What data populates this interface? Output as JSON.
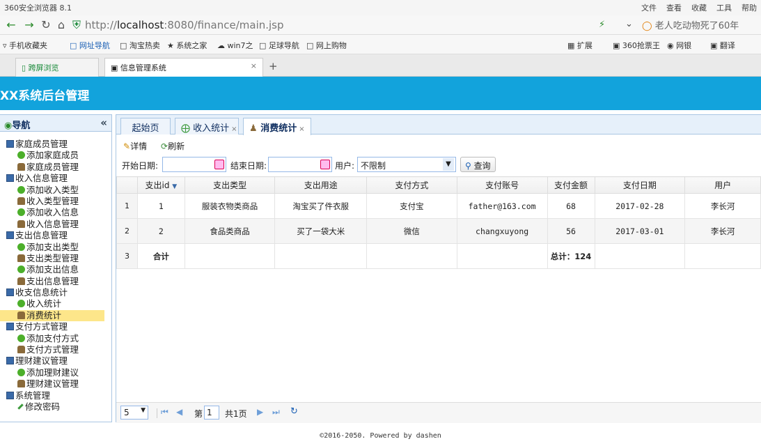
{
  "browser": {
    "window_title": "360安全浏览器 8.1",
    "menu": [
      "文件",
      "查看",
      "收藏",
      "工具",
      "帮助"
    ],
    "url_prefix": "http://",
    "url_host": "localhost",
    "url_rest": ":8080/finance/main.jsp",
    "search_text": "老人吃动物死了60年",
    "favorites": [
      "手机收藏夹",
      "网址导航",
      "淘宝热卖",
      "系统之家",
      "win7之",
      "足球导航",
      "网上购物"
    ],
    "right_tools": [
      "扩展",
      "360抢票王",
      "网银",
      "翻译"
    ],
    "tabs": [
      {
        "label": "跨屏浏览"
      },
      {
        "label": "信息管理系统"
      }
    ],
    "new_tab": "+",
    "close_tab": "×"
  },
  "app": {
    "title": "XX系统后台管理",
    "footer": "©2016-2050. Powered by dashen"
  },
  "sidebar": {
    "title": "导航",
    "collapse": "«",
    "groups": [
      {
        "label": "家庭成员管理",
        "items": [
          {
            "label": "添加家庭成员",
            "icon": "add-icon"
          },
          {
            "label": "家庭成员管理",
            "icon": "user-icon"
          }
        ]
      },
      {
        "label": "收入信息管理",
        "items": [
          {
            "label": "添加收入类型",
            "icon": "add-icon"
          },
          {
            "label": "收入类型管理",
            "icon": "user-icon"
          },
          {
            "label": "添加收入信息",
            "icon": "add-icon"
          },
          {
            "label": "收入信息管理",
            "icon": "user-icon"
          }
        ]
      },
      {
        "label": "支出信息管理",
        "items": [
          {
            "label": "添加支出类型",
            "icon": "add-icon"
          },
          {
            "label": "支出类型管理",
            "icon": "user-icon"
          },
          {
            "label": "添加支出信息",
            "icon": "add-icon"
          },
          {
            "label": "支出信息管理",
            "icon": "user-icon"
          }
        ]
      },
      {
        "label": "收支信息统计",
        "items": [
          {
            "label": "收入统计",
            "icon": "add-icon"
          },
          {
            "label": "消费统计",
            "icon": "user-icon",
            "selected": true
          }
        ]
      },
      {
        "label": "支付方式管理",
        "items": [
          {
            "label": "添加支付方式",
            "icon": "add-icon"
          },
          {
            "label": "支付方式管理",
            "icon": "user-icon"
          }
        ]
      },
      {
        "label": "理财建议管理",
        "items": [
          {
            "label": "添加理财建议",
            "icon": "add-icon"
          },
          {
            "label": "理财建议管理",
            "icon": "user-icon"
          }
        ]
      },
      {
        "label": "系统管理",
        "items": [
          {
            "label": "修改密码",
            "icon": "pen-icon"
          }
        ]
      }
    ]
  },
  "main": {
    "tabs": [
      {
        "label": "起始页",
        "closable": false
      },
      {
        "label": "收入统计",
        "closable": true
      },
      {
        "label": "消费统计",
        "closable": true,
        "active": true
      }
    ],
    "toolbar": {
      "detail": "详情",
      "refresh": "刷新"
    },
    "filter": {
      "start_label": "开始日期:",
      "end_label": "结束日期:",
      "user_label": "用户:",
      "user_value": "不限制",
      "query": "查询"
    },
    "columns": [
      "支出id",
      "支出类型",
      "支出用途",
      "支付方式",
      "支付账号",
      "支付金额",
      "支付日期",
      "用户"
    ],
    "rows": [
      {
        "rn": "1",
        "id": "1",
        "type": "服装衣物类商品",
        "purpose": "淘宝买了件衣服",
        "method": "支付宝",
        "account": "father@163.com",
        "amount": "68",
        "date": "2017-02-28",
        "user": "李长河"
      },
      {
        "rn": "2",
        "id": "2",
        "type": "食品类商品",
        "purpose": "买了一袋大米",
        "method": "微信",
        "account": "changxuyong",
        "amount": "56",
        "date": "2017-03-01",
        "user": "李长河"
      }
    ],
    "total_row": {
      "rn": "3",
      "label": "合计",
      "total": "总计：124"
    },
    "pager": {
      "page_size": "5",
      "page_label": "第",
      "page": "1",
      "total_pages": "共1页"
    }
  }
}
